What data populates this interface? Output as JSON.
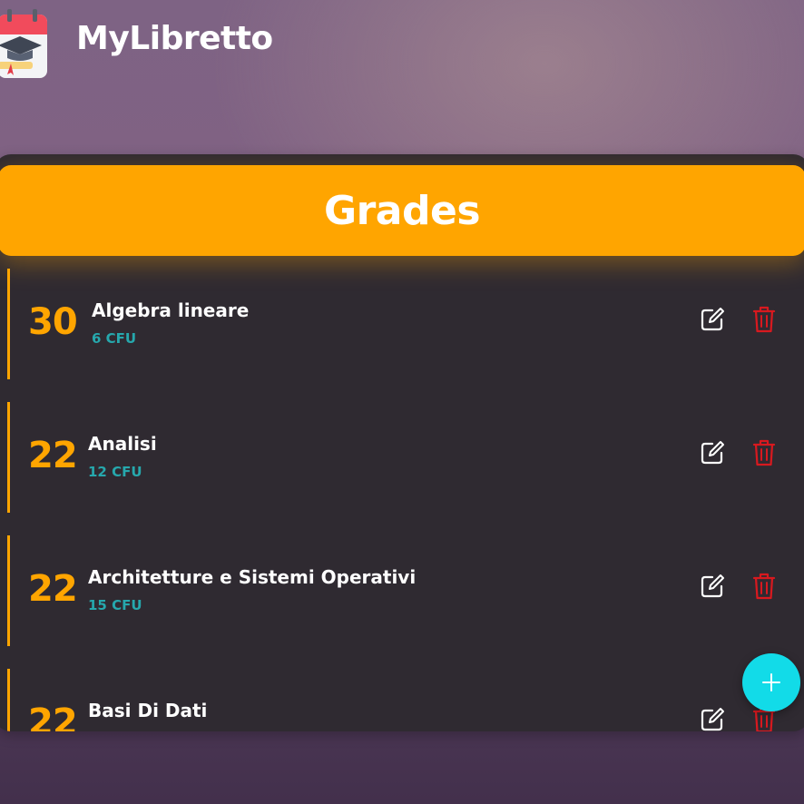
{
  "app": {
    "title": "MyLibretto",
    "logo_icon": "graduation-calendar-icon"
  },
  "grades_card": {
    "title": "Grades",
    "accent_color": "#ffa500",
    "cfu_color": "#26a8ad",
    "delete_color": "#d8191f",
    "items": [
      {
        "grade": "30",
        "course": "Algebra lineare",
        "cfu": "6 CFU"
      },
      {
        "grade": "22",
        "course": "Analisi",
        "cfu": "12 CFU"
      },
      {
        "grade": "22",
        "course": "Architetture e Sistemi Operativi",
        "cfu": "15 CFU"
      },
      {
        "grade": "22",
        "course": "Basi Di Dati",
        "cfu": ""
      }
    ],
    "edit_icon": "edit-icon",
    "delete_icon": "trash-icon"
  },
  "fab": {
    "icon": "plus-icon",
    "color": "#12dbe8"
  }
}
